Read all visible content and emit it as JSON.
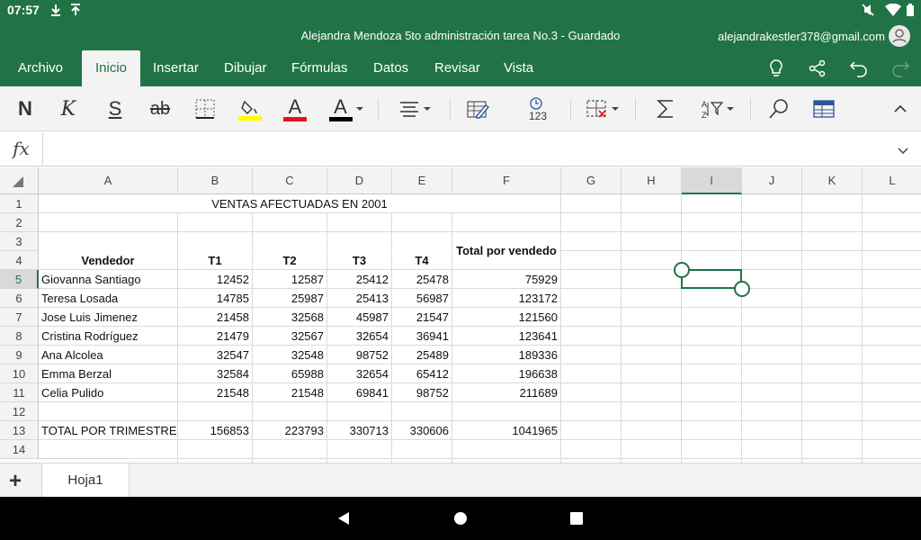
{
  "status_bar": {
    "time": "07:57",
    "icons": [
      "download-icon",
      "upload-icon",
      "mute-icon",
      "wifi-icon",
      "battery-icon"
    ]
  },
  "title_bar": {
    "document_title": "Alejandra Mendoza 5to administración tarea No.3 - Guardado",
    "account": "alejandrakestler378@gmail.com"
  },
  "tabs": [
    {
      "label": "Archivo"
    },
    {
      "label": "Inicio"
    },
    {
      "label": "Insertar"
    },
    {
      "label": "Dibujar"
    },
    {
      "label": "Fórmulas"
    },
    {
      "label": "Datos"
    },
    {
      "label": "Revisar"
    },
    {
      "label": "Vista"
    }
  ],
  "active_tab": "Inicio",
  "ribbon": {
    "bold_label": "N",
    "italic_label": "K",
    "underline_label": "S",
    "strike_label": "ab",
    "font_color_letter": "A",
    "highlight_color": "#ffff00",
    "font_color": "#e81123",
    "text_color": "#000000",
    "number_format_label": "123"
  },
  "formula_bar": {
    "fx_label": "fx",
    "value": ""
  },
  "columns": [
    "A",
    "B",
    "C",
    "D",
    "E",
    "F",
    "G",
    "H",
    "I",
    "J",
    "K",
    "L"
  ],
  "rows": [
    "1",
    "2",
    "3",
    "4",
    "5",
    "6",
    "7",
    "8",
    "9",
    "10",
    "11",
    "12",
    "13",
    "14"
  ],
  "selected_column": "I",
  "selected_row": "5",
  "sheet": {
    "title": "VENTAS AFECTUADAS EN 2001",
    "headers": {
      "vendedor": "Vendedor",
      "t1": "T1",
      "t2": "T2",
      "t3": "T3",
      "t4": "T4",
      "total": "Total por vendedo"
    },
    "data": [
      {
        "name": "Giovanna Santiago",
        "t1": "12452",
        "t2": "12587",
        "t3": "25412",
        "t4": "25478",
        "total": "75929"
      },
      {
        "name": "Teresa Losada",
        "t1": "14785",
        "t2": "25987",
        "t3": "25413",
        "t4": "56987",
        "total": "123172"
      },
      {
        "name": "Jose Luis Jimenez",
        "t1": "21458",
        "t2": "32568",
        "t3": "45987",
        "t4": "21547",
        "total": "121560"
      },
      {
        "name": "Cristina Rodríguez",
        "t1": "21479",
        "t2": "32567",
        "t3": "32654",
        "t4": "36941",
        "total": "123641"
      },
      {
        "name": "Ana Alcolea",
        "t1": "32547",
        "t2": "32548",
        "t3": "98752",
        "t4": "25489",
        "total": "189336"
      },
      {
        "name": "Emma Berzal",
        "t1": "32584",
        "t2": "65988",
        "t3": "32654",
        "t4": "65412",
        "total": "196638"
      },
      {
        "name": "Celia Pulido",
        "t1": "21548",
        "t2": "21548",
        "t3": "69841",
        "t4": "98752",
        "total": "211689"
      }
    ],
    "totals": {
      "label": "TOTAL POR TRIMESTRE",
      "t1": "156853",
      "t2": "223793",
      "t3": "330713",
      "t4": "330606",
      "total": "1041965"
    }
  },
  "sheet_tabs": [
    {
      "label": "Hoja1"
    }
  ],
  "colors": {
    "accent": "#217346",
    "ribbon_bg": "#f3f3f3"
  }
}
